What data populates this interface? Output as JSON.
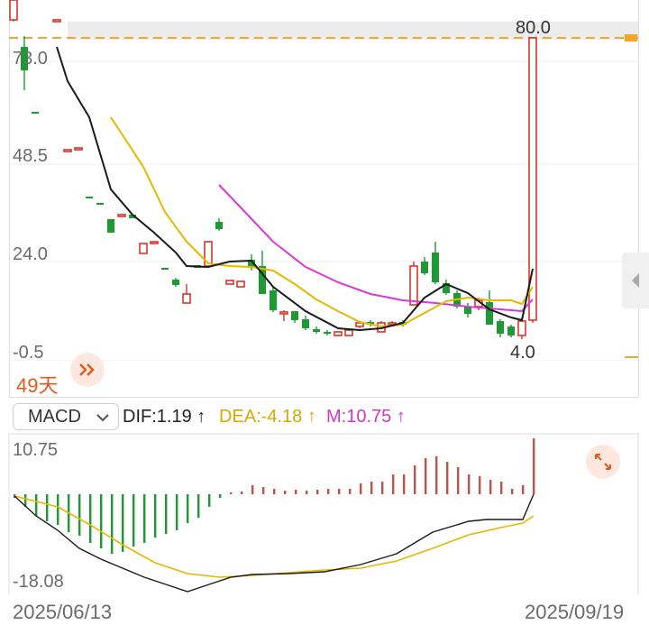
{
  "kline": {
    "y_labels": [
      "73.0",
      "48.5",
      "24.0",
      "-0.5"
    ],
    "high_label": "80.0",
    "low_label": "4.0",
    "days_label": "49天",
    "colors": {
      "up": "#d9342b",
      "down": "#1e9a32",
      "ma5": "#1a1a1a",
      "ma10": "#e6b800",
      "ma20": "#d63ad6",
      "ref": "#f0a72c"
    }
  },
  "macd": {
    "selector_label": "MACD",
    "dif_label": "DIF:1.19",
    "dea_label": "DEA:-4.18",
    "m_label": "M:10.75",
    "arrow": "↑",
    "y_top": "10.75",
    "y_bottom": "-18.08",
    "colors": {
      "dif": "#d9a800",
      "dea": "#d9a800",
      "m": "#c93ac9"
    }
  },
  "dates": {
    "start": "2025/06/13",
    "end": "2025/09/19"
  },
  "icons": [
    "double-chevron-right-icon",
    "chevron-down-icon",
    "expand-arrows-icon",
    "chevron-left-icon"
  ]
}
